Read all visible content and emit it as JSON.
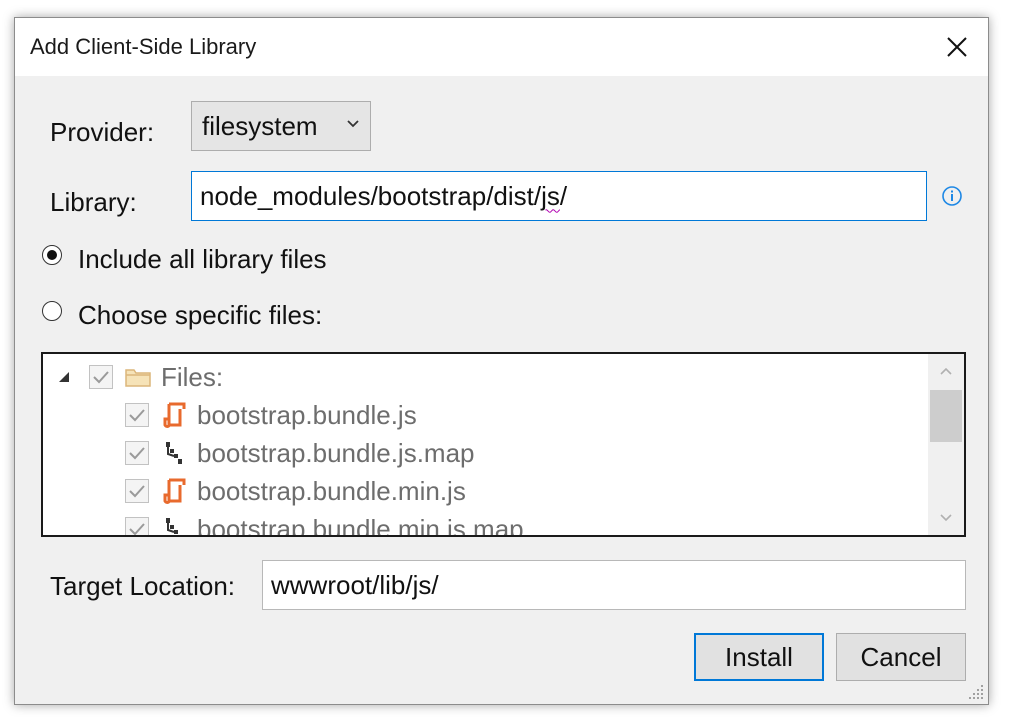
{
  "dialog": {
    "title": "Add Client-Side Library"
  },
  "provider": {
    "label": "Provider:",
    "value": "filesystem"
  },
  "library": {
    "label": "Library:",
    "value_prefix": "node_modules/bootstrap/dist/",
    "value_flagged": "js",
    "value_suffix": "/"
  },
  "options": {
    "include_all": "Include all library files",
    "choose_specific": "Choose specific files:"
  },
  "tree": {
    "root_label": "Files:",
    "files": [
      {
        "name": "bootstrap.bundle.js",
        "icon": "js-file-icon"
      },
      {
        "name": "bootstrap.bundle.js.map",
        "icon": "map-file-icon"
      },
      {
        "name": "bootstrap.bundle.min.js",
        "icon": "js-file-icon"
      },
      {
        "name": "bootstrap.bundle.min.js.map",
        "icon": "map-file-icon"
      }
    ]
  },
  "target": {
    "label": "Target Location:",
    "value": "wwwroot/lib/js/"
  },
  "buttons": {
    "install": "Install",
    "cancel": "Cancel"
  },
  "colors": {
    "accent": "#0078d7",
    "js_icon": "#e86a2d",
    "folder_icon": "#dcb67a"
  }
}
